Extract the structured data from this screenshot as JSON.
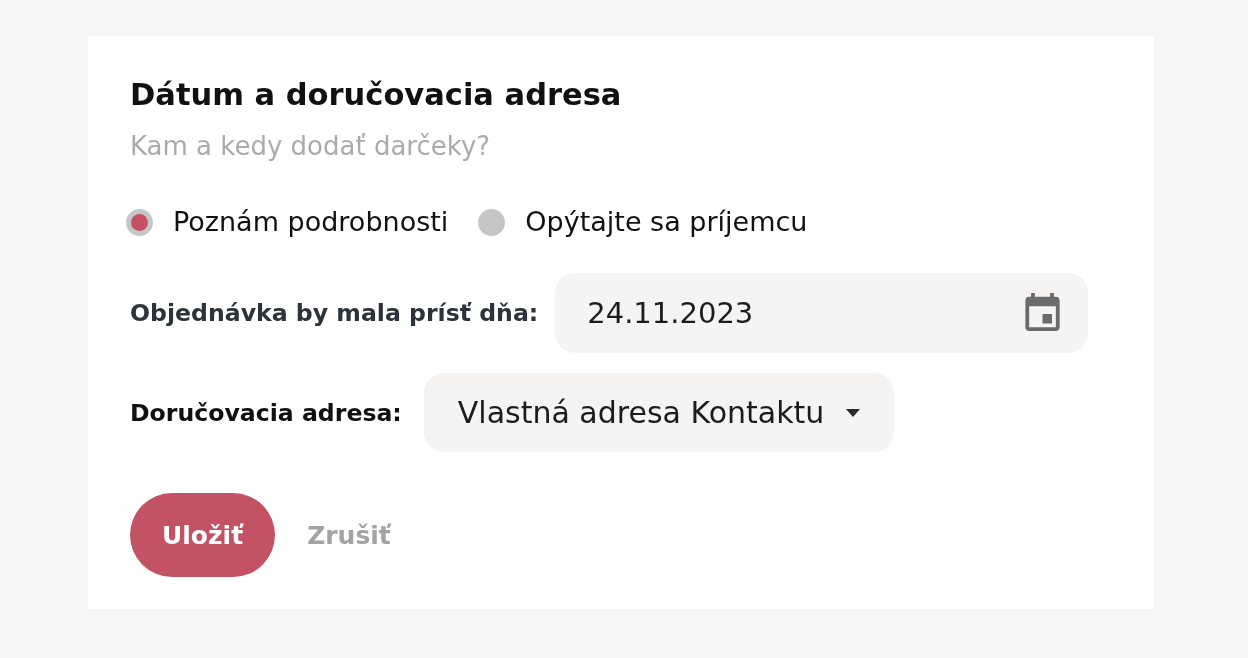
{
  "card": {
    "title": "Dátum a doručovacia adresa",
    "subtitle": "Kam a kedy dodať darčeky?",
    "options": [
      {
        "label": "Poznám podrobnosti",
        "selected": true
      },
      {
        "label": "Opýtajte sa príjemcu",
        "selected": false
      }
    ],
    "fields": [
      {
        "kind": "date",
        "label": "Objednávka by mala prísť dňa:",
        "value": "24.11.2023"
      },
      {
        "kind": "select",
        "label": "Doručovacia adresa:",
        "value": "Vlastná adresa Kontaktu"
      }
    ],
    "buttons": [
      {
        "kind": "primary",
        "label": "Uložiť"
      },
      {
        "kind": "secondary",
        "label": "Zrušiť"
      }
    ]
  }
}
